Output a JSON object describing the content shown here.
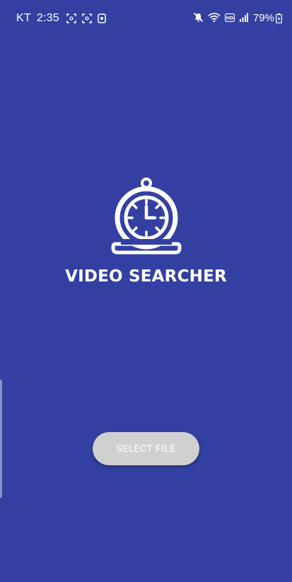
{
  "status_bar": {
    "carrier": "KT",
    "time": "2:35",
    "battery": "79%",
    "icons": [
      "screenshot-icon",
      "screenshot-icon",
      "camera-icon",
      "mute-icon",
      "wifi-icon",
      "hd-icon",
      "signal-icon",
      "battery-icon"
    ]
  },
  "app": {
    "title": "VIDEO SEARCHER",
    "logo_icon": "stopwatch-icon"
  },
  "actions": {
    "select_file_label": "SELECT FILE"
  },
  "colors": {
    "background": "#3440a1",
    "button": "#d0d0d0",
    "text": "#ffffff"
  }
}
